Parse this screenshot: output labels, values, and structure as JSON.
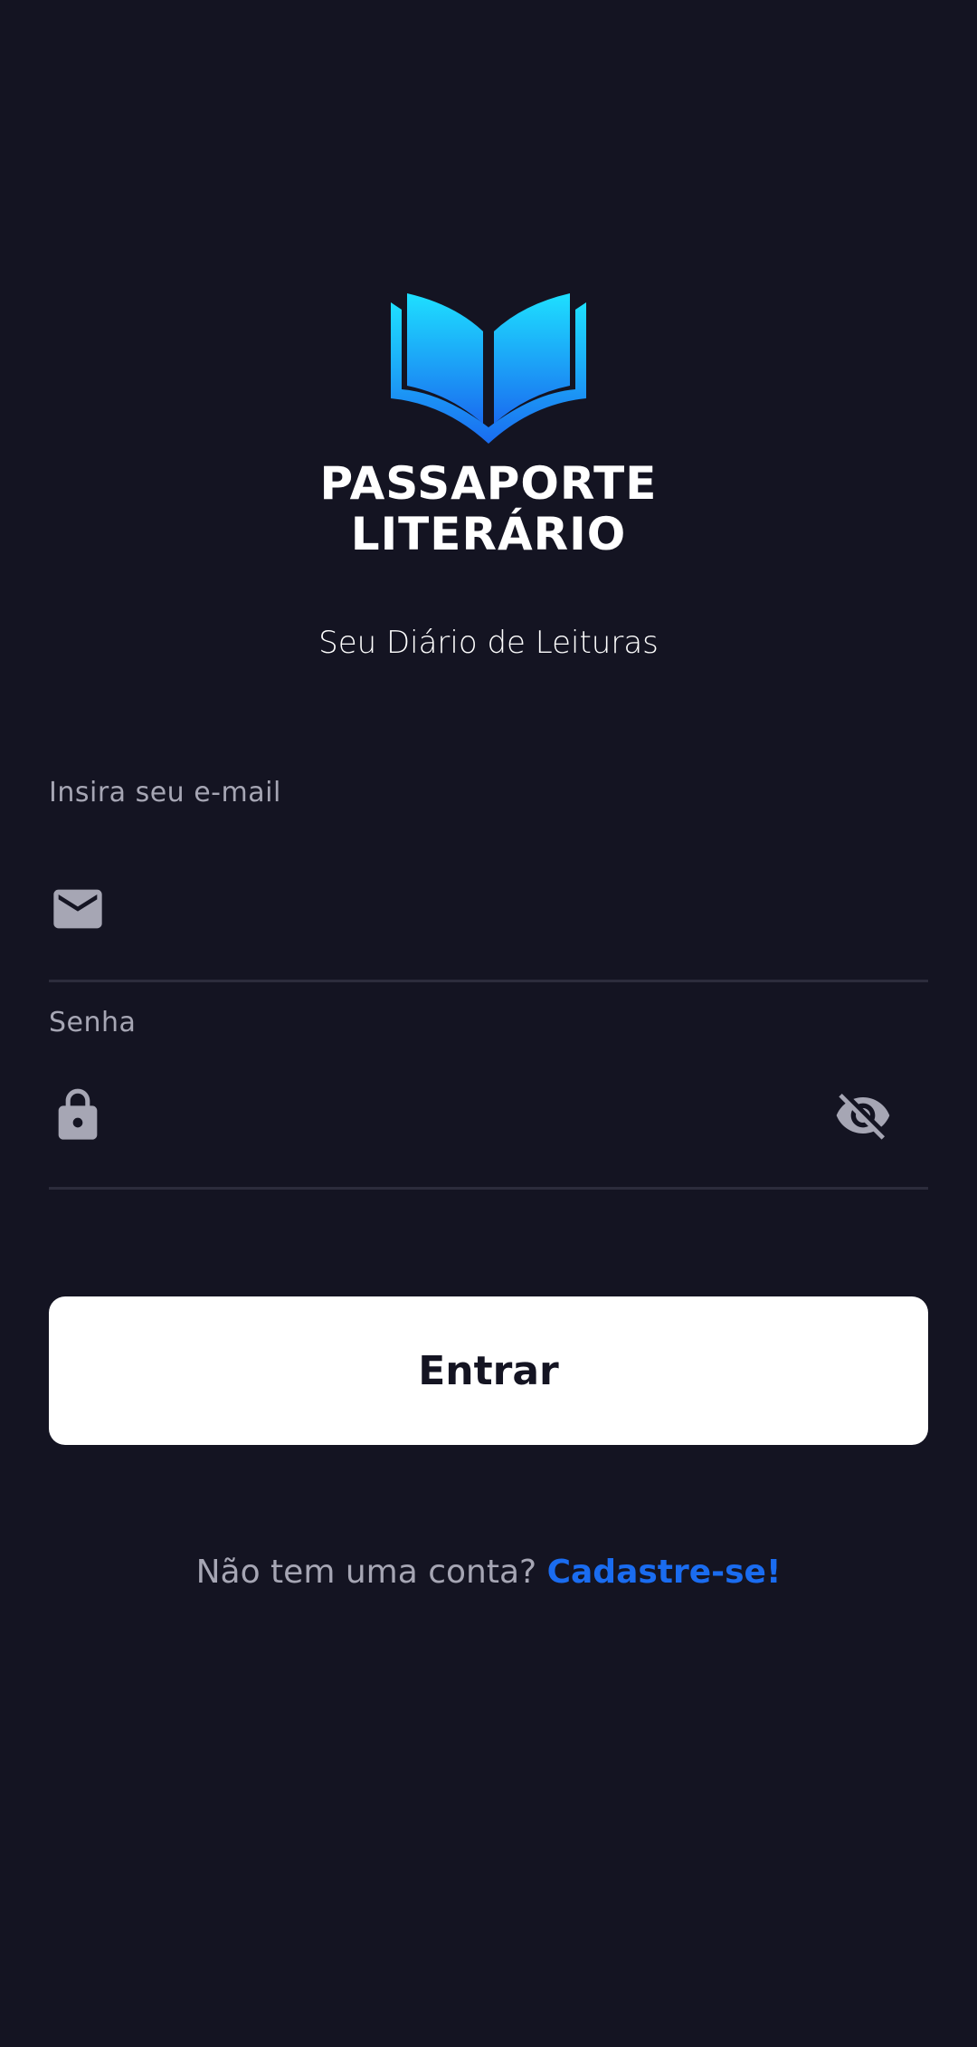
{
  "brand": {
    "line1": "PASSAPORTE",
    "line2": "LITERÁRIO",
    "tagline": "Seu Diário de Leituras",
    "logo_icon": "open-book-icon",
    "logo_gradient": [
      "#1ee0ff",
      "#1a6cf0"
    ]
  },
  "form": {
    "email": {
      "label": "Insira seu e-mail",
      "value": "",
      "icon": "mail-icon"
    },
    "password": {
      "label": "Senha",
      "value": "",
      "icon": "lock-icon",
      "toggle_icon": "eye-off-icon"
    },
    "submit_label": "Entrar"
  },
  "signup": {
    "prompt": "Não tem uma conta?",
    "link_label": "Cadastre-se!"
  },
  "colors": {
    "background": "#141422",
    "accent": "#1a6cf0",
    "muted_text": "#a6a6b4",
    "divider": "#2c2c3c"
  }
}
